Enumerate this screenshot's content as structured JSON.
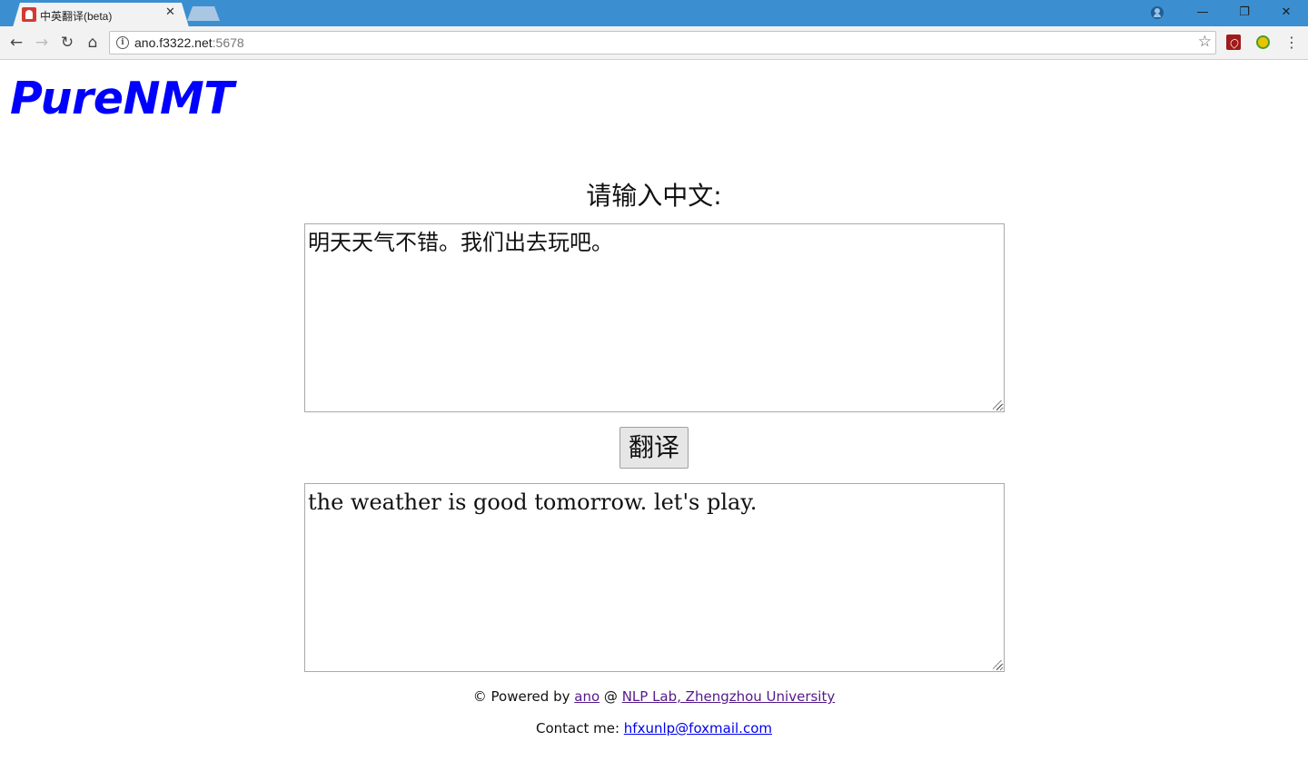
{
  "browser": {
    "tab_title": "中英翻译(beta)",
    "tab_close_glyph": "✕",
    "url_host": "ano.f3322.net",
    "url_port": ":5678",
    "back_glyph": "←",
    "forward_glyph": "→",
    "reload_glyph": "↻",
    "home_glyph": "⌂",
    "info_glyph": "i",
    "star_glyph": "☆",
    "menu_glyph": "⋮",
    "minimize_glyph": "—",
    "restore_glyph": "❐",
    "close_glyph": "✕",
    "accent_color": "#3b8fd1"
  },
  "page": {
    "brand": "PureNMT",
    "brand_color": "#0000ff",
    "prompt": "请输入中文:",
    "source_text": "明天天气不错。我们出去玩吧。",
    "translate_button": "翻译",
    "output_text": "the weather is good tomorrow. let's play."
  },
  "footer": {
    "powered_prefix": "© Powered by ",
    "author_link": "ano",
    "at_sep": " @ ",
    "lab_link": "NLP Lab, Zhengzhou University",
    "contact_prefix": "Contact me: ",
    "contact_email": "hfxunlp@foxmail.com"
  }
}
